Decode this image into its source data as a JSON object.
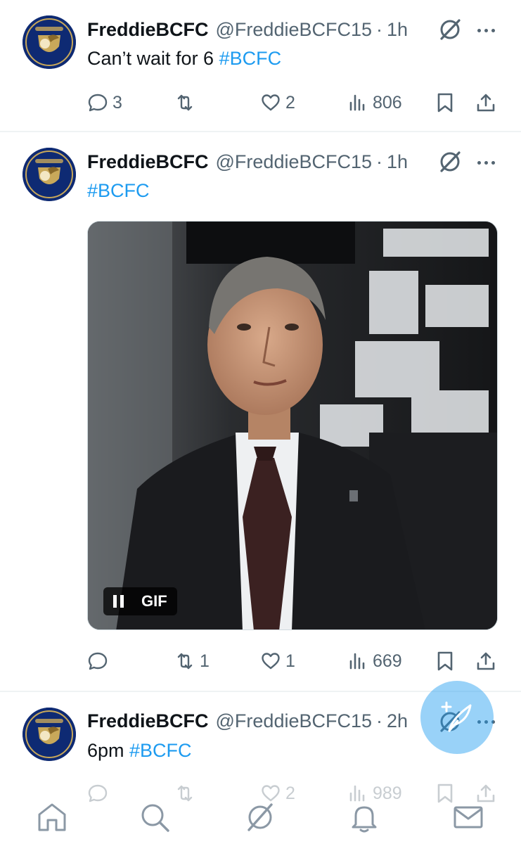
{
  "colors": {
    "text": "#0f1419",
    "secondary": "#536471",
    "accent": "#1d9bf0",
    "divider": "#eff3f4"
  },
  "tweets": [
    {
      "name": "FreddieBCFC",
      "handle": "@FreddieBCFC15",
      "separator": "·",
      "time": "1h",
      "text": "Can’t wait for 6 ",
      "hashtag": "#BCFC",
      "stats": {
        "replies": "3",
        "reposts": "",
        "likes": "2",
        "views": "806"
      }
    },
    {
      "name": "FreddieBCFC",
      "handle": "@FreddieBCFC15",
      "separator": "·",
      "time": "1h",
      "text": "",
      "hashtag": "#BCFC",
      "media": {
        "type": "gif",
        "badge": "GIF",
        "icon": "pause-icon"
      },
      "stats": {
        "replies": "",
        "reposts": "1",
        "likes": "1",
        "views": "669"
      }
    },
    {
      "name": "FreddieBCFC",
      "handle": "@FreddieBCFC15",
      "separator": "·",
      "time": "2h",
      "text": "6pm ",
      "hashtag": "#BCFC",
      "stats": {
        "replies": "",
        "reposts": "",
        "likes": "2",
        "views": "989"
      }
    }
  ],
  "compose_button": {
    "icon": "compose-plus-icon"
  },
  "bottom_nav": [
    {
      "name": "home",
      "icon": "home-icon"
    },
    {
      "name": "search",
      "icon": "search-icon"
    },
    {
      "name": "grok",
      "icon": "grok-icon"
    },
    {
      "name": "notifications",
      "icon": "bell-icon"
    },
    {
      "name": "messages",
      "icon": "mail-icon"
    }
  ]
}
